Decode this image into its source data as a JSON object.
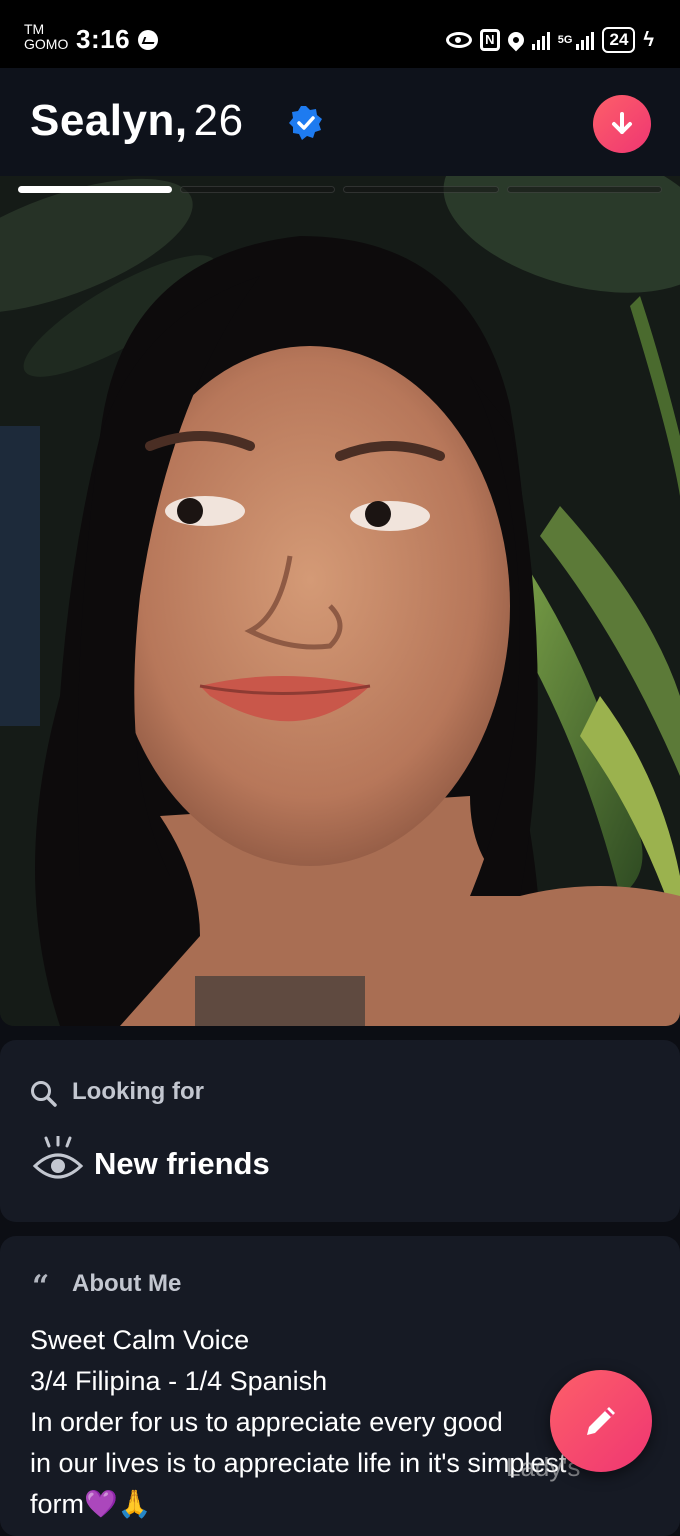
{
  "status_bar": {
    "carrier": "TM\nGOMO",
    "time": "3:16",
    "network": "5G",
    "battery": "24"
  },
  "profile": {
    "name": "Sealyn,",
    "age": "26",
    "verified": true,
    "photo_count": 4,
    "current_photo": 1
  },
  "looking_for": {
    "label": "Looking for",
    "value": "New friends",
    "icon": "eye-icon"
  },
  "about_me": {
    "label": "About Me",
    "lines": [
      "Sweet Calm Voice",
      "3/4 Filipina - 1/4 Spanish",
      "In order for us to appreciate every good",
      "in our lives is to appreciate life in it's simplest",
      "form"
    ],
    "emojis": "💜🙏"
  },
  "watermark": "Lady's",
  "colors": {
    "accent_gradient_start": "#fd5f69",
    "accent_gradient_end": "#ef3672",
    "verified_blue": "#1e7bf0",
    "card_bg": "#161a24",
    "page_bg": "#0c0e14"
  }
}
